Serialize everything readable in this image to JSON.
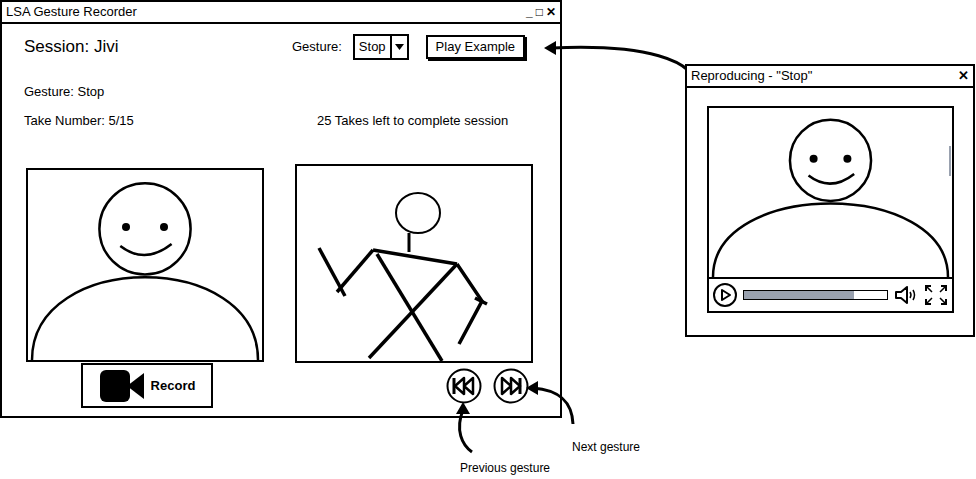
{
  "main_window": {
    "title": "LSA Gesture Recorder",
    "controls": [
      "_",
      "□",
      "✕"
    ]
  },
  "session": {
    "label": "Session: Jivi"
  },
  "gesture_select": {
    "label": "Gesture:",
    "value": "Stop"
  },
  "play_button": {
    "label": "Play Example"
  },
  "gesture_label": "Gesture: Stop",
  "take_number": "Take Number: 5/15",
  "takes_left": "25 Takes left to complete session",
  "record_button": {
    "label": "Record"
  },
  "annotations": [
    {
      "label": "Next gesture"
    },
    {
      "label": "Previous gesture"
    }
  ],
  "player_window": {
    "title": "Reproducing - \"Stop\"",
    "close": "✕",
    "progress": {
      "level": 0.77
    }
  }
}
